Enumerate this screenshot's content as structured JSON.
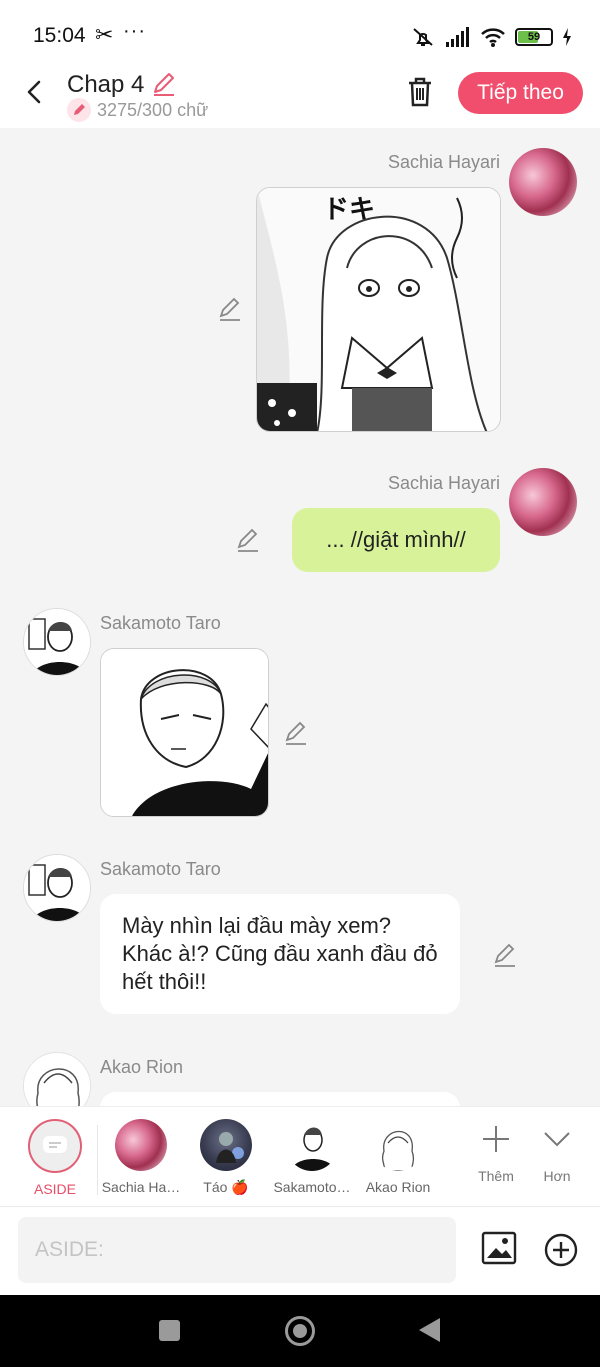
{
  "status_bar": {
    "time": "15:04",
    "app_glyph": "✂",
    "more": "···",
    "battery": "59"
  },
  "header": {
    "title": "Chap 4",
    "word_count": "3275/300 chữ",
    "next_label": "Tiếp theo"
  },
  "messages": [
    {
      "sender": "Sachia Hayari",
      "side": "right",
      "kind": "image",
      "image": "manga girl in maid outfit with 'doki' sound effect"
    },
    {
      "sender": "Sachia Hayari",
      "side": "right",
      "kind": "text",
      "text": "... //giật mình//"
    },
    {
      "sender": "Sakamoto Taro",
      "side": "left",
      "kind": "image",
      "image": "manga boy with slicked-back hair"
    },
    {
      "sender": "Sakamoto Taro",
      "side": "left",
      "kind": "text",
      "text": "Mày nhìn lại đầu mày xem? Khác à!? Cũng đầu xanh đầu đỏ hết thôi!!"
    },
    {
      "sender": "Akao Rion",
      "side": "left",
      "kind": "text",
      "text": ""
    }
  ],
  "characters": [
    {
      "label": "ASIDE",
      "icon": "aside-chat-icon"
    },
    {
      "label": "Sachia Ha…",
      "icon": "sachia-avatar"
    },
    {
      "label": "Táo 🍎",
      "icon": "tao-avatar"
    },
    {
      "label": "Sakamoto…",
      "icon": "sakamoto-avatar"
    },
    {
      "label": "Akao Rion",
      "icon": "akao-avatar"
    }
  ],
  "tools": {
    "add_label": "Thêm",
    "more_label": "Hơn"
  },
  "input": {
    "placeholder": "ASIDE:",
    "value": ""
  },
  "colors": {
    "accent": "#f04e6c",
    "green_bubble": "#d8f29a",
    "background": "#f4f4f4"
  }
}
